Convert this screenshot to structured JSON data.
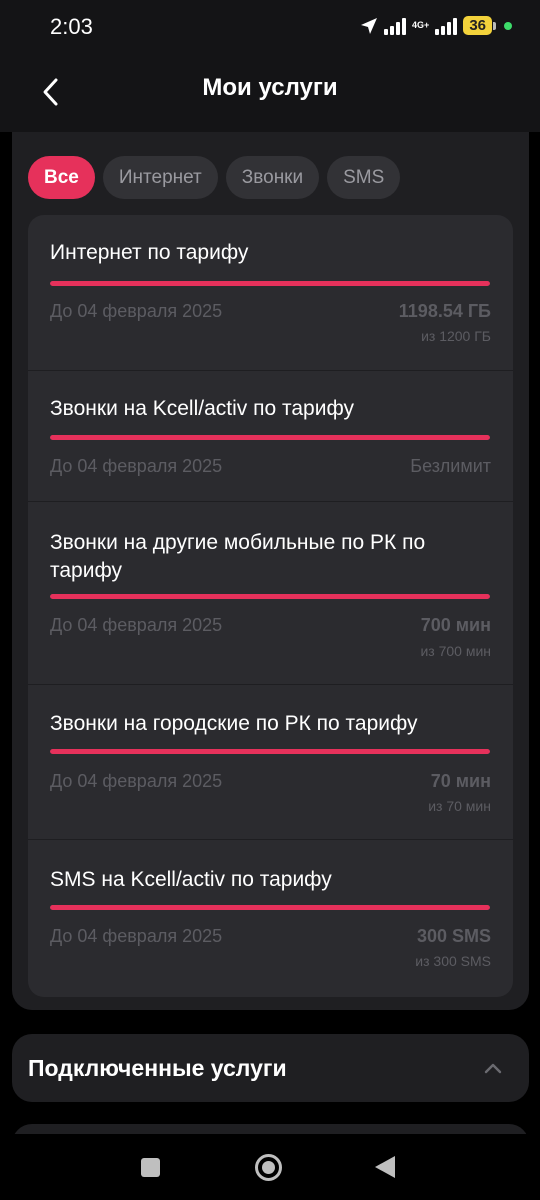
{
  "status": {
    "time": "2:03",
    "network": "4G+",
    "battery": "36"
  },
  "header": {
    "title": "Мои услуги"
  },
  "filters": [
    "Все",
    "Интернет",
    "Звонки",
    "SMS"
  ],
  "services": [
    {
      "title": "Интернет по тарифу",
      "date": "До 04 февраля 2025",
      "amount": "1198.54 ГБ",
      "of": "из 1200 ГБ",
      "progress": 0.999
    },
    {
      "title": "Звонки на Kcell/activ по тарифу",
      "date": "До 04 февраля 2025",
      "amount": "Безлимит",
      "of": "",
      "progress": 1.0
    },
    {
      "title": "Звонки на другие мобильные по РК по тарифу",
      "date": "До 04 февраля 2025",
      "amount": "700 мин",
      "of": "из 700 мин",
      "progress": 1.0
    },
    {
      "title": "Звонки на городские по РК по тарифу",
      "date": "До 04 февраля 2025",
      "amount": "70 мин",
      "of": "из 70 мин",
      "progress": 1.0
    },
    {
      "title": "SMS на Kcell/activ по тарифу",
      "date": "До 04 февраля 2025",
      "amount": "300 SMS",
      "of": "из 300 SMS",
      "progress": 1.0
    }
  ],
  "connected": {
    "title": "Подключенные услуги"
  },
  "colors": {
    "accent": "#e6315b",
    "card": "#2b2b2f",
    "background": "#000000"
  }
}
